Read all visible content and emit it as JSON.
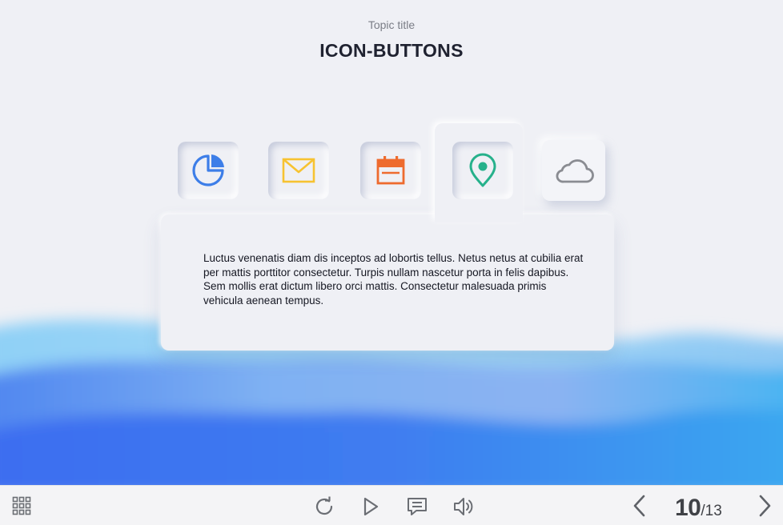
{
  "header": {
    "topic": "Topic title",
    "title": "ICON-BUTTONS"
  },
  "icon_buttons": [
    {
      "icon": "pie-chart-icon",
      "color": "#3d7ee8",
      "state": "pressed"
    },
    {
      "icon": "mail-icon",
      "color": "#f7c331",
      "state": "pressed"
    },
    {
      "icon": "calendar-icon",
      "color": "#ee6b2e",
      "state": "pressed"
    },
    {
      "icon": "location-pin-icon",
      "color": "#26b18b",
      "state": "selected"
    },
    {
      "icon": "cloud-icon",
      "color": "#8a8c92",
      "state": "raised"
    }
  ],
  "panel": {
    "text": "Luctus venenatis diam dis inceptos ad lobortis tellus. Netus netus at cubilia erat per mattis porttitor consectetur. Turpis nullam nascetur porta in felis dapibus. Sem mollis erat dictum libero orci mattis. Consectetur malesuada primis vehicula aenean tempus."
  },
  "footer": {
    "menu_icon": "grid-menu-icon",
    "replay_icon": "replay-icon",
    "play_icon": "play-icon",
    "notes_icon": "notes-icon",
    "volume_icon": "volume-icon",
    "prev_icon": "chevron-left-icon",
    "next_icon": "chevron-right-icon",
    "current_slide": "10",
    "total_slides": "/13"
  },
  "colors": {
    "background": "#eff0f5",
    "wave_blue": "#3f6fef",
    "wave_light": "#7fc4f4",
    "footer_bg": "#f4f4f6",
    "icon_gray": "#6b6e74"
  }
}
